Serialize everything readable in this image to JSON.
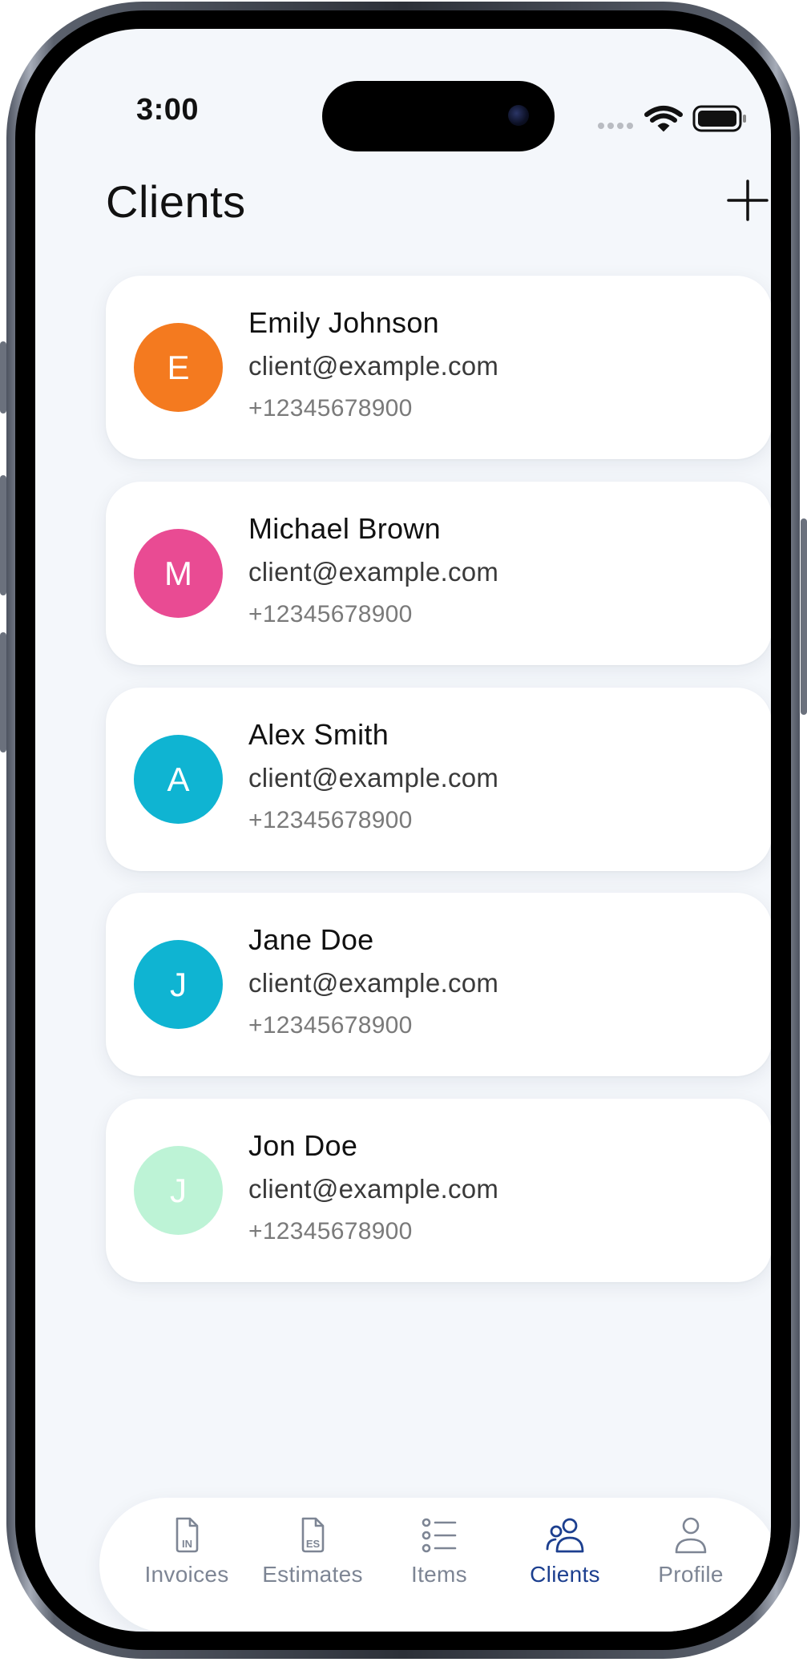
{
  "status_bar": {
    "time": "3:00"
  },
  "header": {
    "title": "Clients",
    "add_icon": "plus-icon"
  },
  "clients": [
    {
      "initial": "E",
      "name": "Emily Johnson",
      "email": "client@example.com",
      "phone": "+12345678900",
      "color": "#f47a1f"
    },
    {
      "initial": "M",
      "name": "Michael Brown",
      "email": "client@example.com",
      "phone": "+12345678900",
      "color": "#e94b93"
    },
    {
      "initial": "A",
      "name": "Alex Smith",
      "email": "client@example.com",
      "phone": "+12345678900",
      "color": "#0fb4d2"
    },
    {
      "initial": "J",
      "name": "Jane Doe",
      "email": "client@example.com",
      "phone": "+12345678900",
      "color": "#0fb4d2"
    },
    {
      "initial": "J",
      "name": "Jon Doe",
      "email": "client@example.com",
      "phone": "+12345678900",
      "color": "#bdf3d6"
    }
  ],
  "tabs": [
    {
      "label": "Invoices",
      "icon": "invoice-doc-icon",
      "icon_text": "IN"
    },
    {
      "label": "Estimates",
      "icon": "estimate-doc-icon",
      "icon_text": "ES"
    },
    {
      "label": "Items",
      "icon": "list-icon"
    },
    {
      "label": "Clients",
      "icon": "users-icon",
      "active": true
    },
    {
      "label": "Profile",
      "icon": "user-icon"
    }
  ],
  "colors": {
    "active_tab": "#1c3f8f",
    "inactive_tab": "#7d8594",
    "background": "#f4f7fb"
  }
}
